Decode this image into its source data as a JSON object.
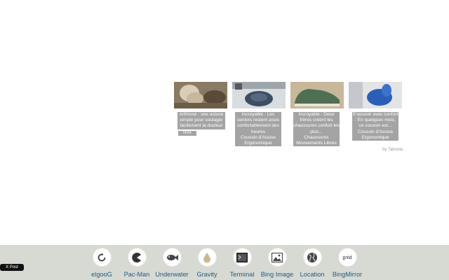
{
  "cards": [
    {
      "caption": "Arthrose : une astuce simple pour soulager facilement la douleur",
      "sponsor": "NVA"
    },
    {
      "caption": "Incroyable : Les seniors restent assis confortablement des heures",
      "sponsor": "Coussin d'Assise Ergonomique"
    },
    {
      "caption": "Incroyable : Deux frères créent les chaussures confort les plus...",
      "sponsor": "Chaussures Mouvements Libres"
    },
    {
      "caption": "S'asseoir avec confort : En quelques mois, ce coussin est...",
      "sponsor": "Coussin d'Assise Ergonomique"
    }
  ],
  "by_label": "by Taboola",
  "tools": [
    {
      "label": "elgooG",
      "icon": "elgoog-icon"
    },
    {
      "label": "Pac-Man",
      "icon": "pacman-icon"
    },
    {
      "label": "Underwater",
      "icon": "fish-icon"
    },
    {
      "label": "Gravity",
      "icon": "drop-icon"
    },
    {
      "label": "Terminal",
      "icon": "terminal-icon"
    },
    {
      "label": "Bing Image",
      "icon": "image-icon"
    },
    {
      "label": "Location",
      "icon": "globe-icon"
    },
    {
      "label": "BingMirror",
      "icon": "bing-mirror-icon"
    }
  ],
  "tweet_label": "X Post"
}
